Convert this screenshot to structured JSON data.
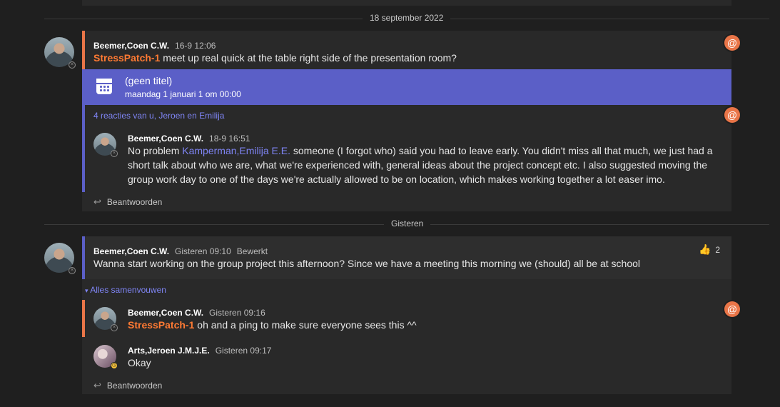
{
  "dates": {
    "first": "18 september 2022",
    "second": "Gisteren"
  },
  "thread1": {
    "author": "Beemer,Coen C.W.",
    "time": "16-9 12:06",
    "mention": "StressPatch-1",
    "text": " meet up real quick at the table right side of the presentation room?",
    "event": {
      "title": "(geen titel)",
      "subtitle": "maandag 1 januari 1 om 00:00",
      "icon": "calendar-icon"
    },
    "reactions_link": "4 reacties van u, Jeroen en Emilija",
    "reply": {
      "author": "Beemer,Coen C.W.",
      "time": "18-9 16:51",
      "text_pre": "No problem ",
      "mention": "Kamperman,Emilija E.E.",
      "line1_rest": " someone (I forgot who) said you had to leave early. You didn't miss all that much, we just had a",
      "line2": "short talk about who we are, what we're experienced with, general ideas about the project concept etc. I also suggested moving the",
      "line3": "group work day to one of the days we're actually allowed to be on location, which makes working together a lot easer imo."
    },
    "reply_label": "Beantwoorden"
  },
  "thread2": {
    "author": "Beemer,Coen C.W.",
    "time": "Gisteren 09:10",
    "edited": "Bewerkt",
    "text": "Wanna start working on the group project this afternoon? Since we have a meeting this morning we (should) all be at school",
    "reaction_emoji": "👍",
    "reaction_count": "2",
    "collapse_label": "Alles samenvouwen",
    "reply1": {
      "author": "Beemer,Coen C.W.",
      "time": "Gisteren 09:16",
      "mention": "StressPatch-1",
      "text": " oh and a ping to make sure everyone sees this ^^"
    },
    "reply2": {
      "author": "Arts,Jeroen J.M.J.E.",
      "time": "Gisteren 09:17",
      "text": "Okay"
    },
    "reply_label": "Beantwoorden"
  },
  "icons": {
    "mention": "@",
    "reply": "↩",
    "collapse": "▾"
  },
  "colors": {
    "accent": "#5b5fc7",
    "mention_me": "#ff7a33",
    "at_badge": "#e97548",
    "background": "#1f1f1f",
    "card": "#292929"
  }
}
